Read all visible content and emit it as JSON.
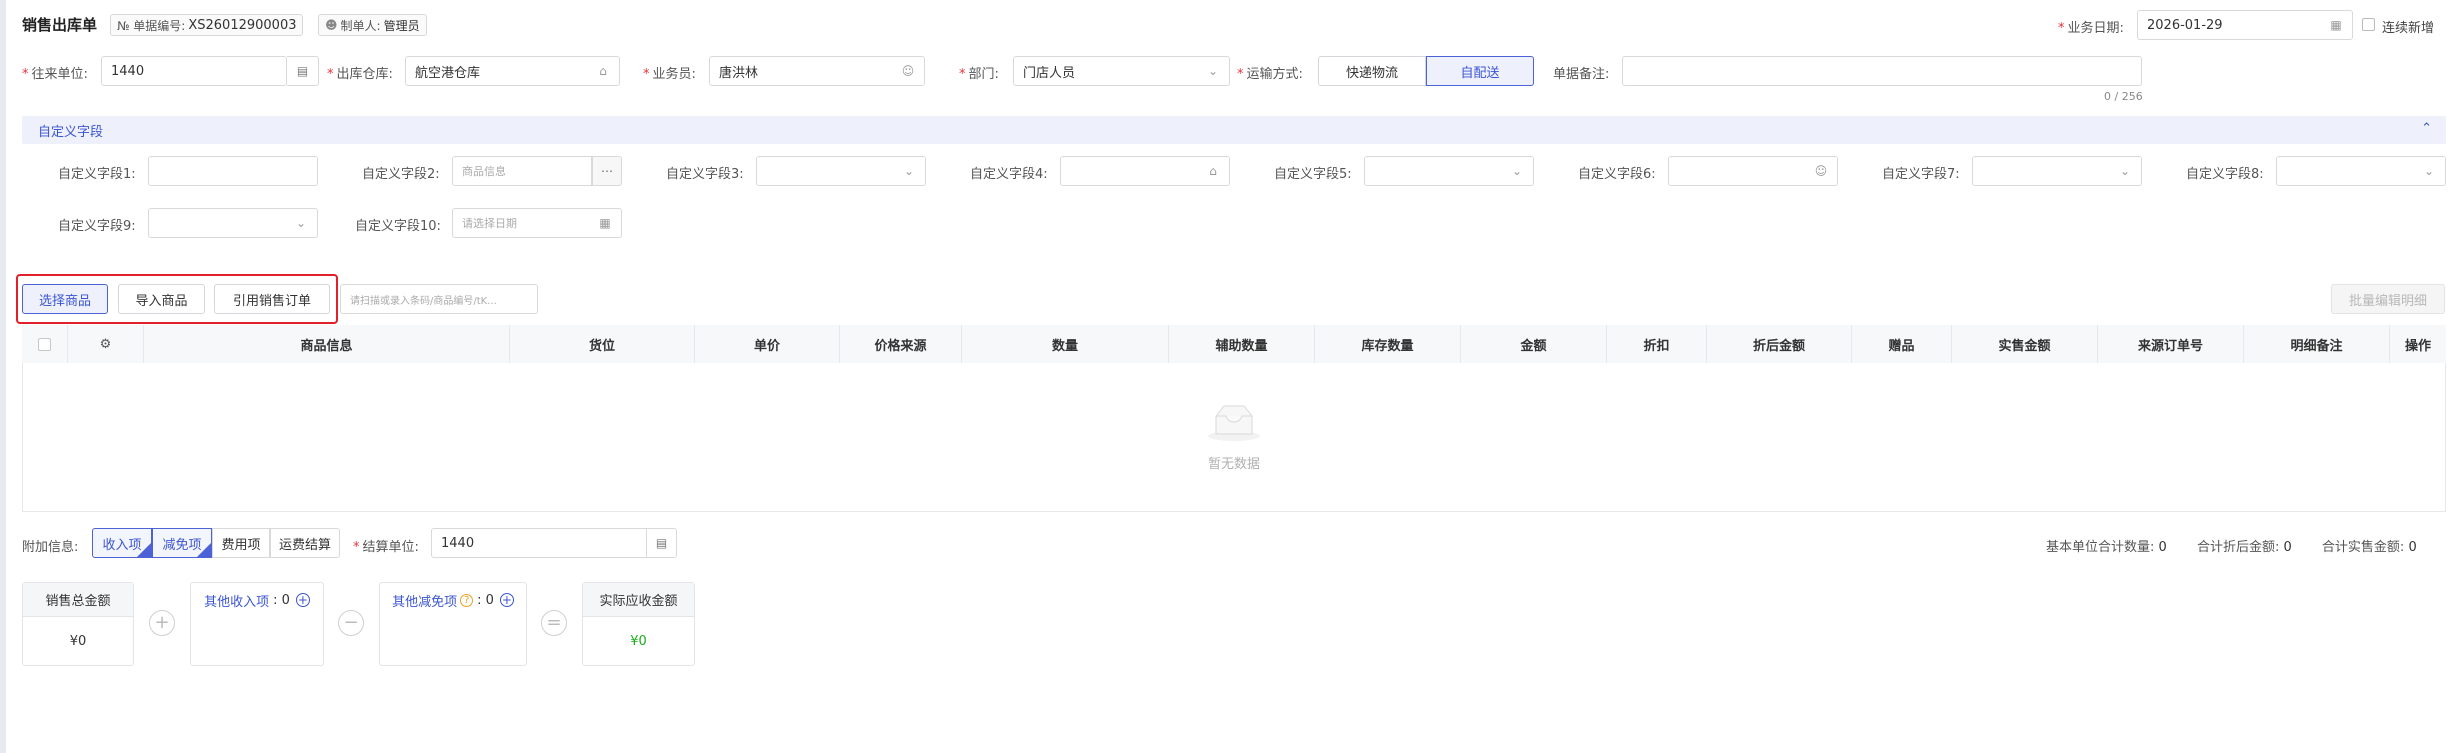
{
  "header": {
    "title": "销售出库单",
    "doc_no_label": "№ 单据编号:",
    "doc_no_value": "XS26012900003",
    "creator_label": "制单人:",
    "creator_value": "管理员",
    "biz_date_label": "业务日期:",
    "biz_date_value": "2026-01-29",
    "continuous_add_label": "连续新增"
  },
  "form": {
    "partner_label": "往来单位:",
    "partner_value": "1440",
    "warehouse_label": "出库仓库:",
    "warehouse_value": "航空港仓库",
    "salesman_label": "业务员:",
    "salesman_value": "唐洪林",
    "dept_label": "部门:",
    "dept_value": "门店人员",
    "transport_label": "运输方式:",
    "transport_options": [
      "快递物流",
      "自配送"
    ],
    "transport_selected": "自配送",
    "remark_label": "单据备注:",
    "remark_count": "0 / 256"
  },
  "custom": {
    "section_title": "自定义字段",
    "fields": [
      {
        "label": "自定义字段1:",
        "placeholder": ""
      },
      {
        "label": "自定义字段2:",
        "placeholder": "商品信息"
      },
      {
        "label": "自定义字段3:",
        "placeholder": ""
      },
      {
        "label": "自定义字段4:",
        "placeholder": ""
      },
      {
        "label": "自定义字段5:",
        "placeholder": ""
      },
      {
        "label": "自定义字段6:",
        "placeholder": ""
      },
      {
        "label": "自定义字段7:",
        "placeholder": ""
      },
      {
        "label": "自定义字段8:",
        "placeholder": ""
      },
      {
        "label": "自定义字段9:",
        "placeholder": ""
      },
      {
        "label": "自定义字段10:",
        "placeholder": "请选择日期"
      }
    ]
  },
  "toolbar": {
    "select_goods": "选择商品",
    "import_goods": "导入商品",
    "ref_order": "引用销售订单",
    "scan_placeholder": "请扫描或录入条码/商品编号/tK...",
    "batch_edit": "批量编辑明细"
  },
  "table": {
    "columns": [
      "商品信息",
      "货位",
      "单价",
      "价格来源",
      "数量",
      "辅助数量",
      "库存数量",
      "金额",
      "折扣",
      "折后金额",
      "赠品",
      "实售金额",
      "来源订单号",
      "明细备注",
      "操作"
    ],
    "empty_text": "暂无数据"
  },
  "footer": {
    "extra_label": "附加信息:",
    "tabs": [
      "收入项",
      "减免项",
      "费用项",
      "运费结算"
    ],
    "settle_label": "结算单位:",
    "settle_value": "1440",
    "base_qty_label": "基本单位合计数量:",
    "base_qty_value": "0",
    "discount_total_label": "合计折后金额:",
    "discount_total_value": "0",
    "actual_total_label": "合计实售金额:",
    "actual_total_value": "0"
  },
  "summary": {
    "sales_total_label": "销售总金额",
    "sales_total_value": "¥0",
    "other_income_label": "其他收入项",
    "other_income_value": ": 0",
    "other_deduct_label": "其他减免项",
    "other_deduct_value": ": 0",
    "actual_receivable_label": "实际应收金额",
    "actual_receivable_value": "¥0"
  },
  "colors": {
    "accent": "#3b55d0",
    "required": "#e6333a",
    "highlight_box": "#e0202a",
    "green": "#1aad19",
    "section_bg": "#eef1fb"
  }
}
